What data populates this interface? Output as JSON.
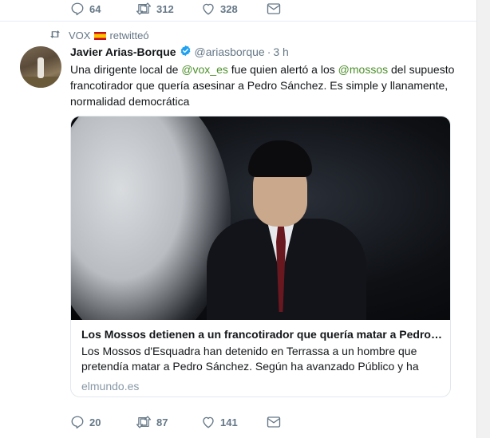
{
  "previous_tweet": {
    "reply_count": "64",
    "retweet_count": "312",
    "like_count": "328"
  },
  "retweet_context": {
    "retweeter": "VOX",
    "label": "retwitteó"
  },
  "tweet": {
    "author_name": "Javier Arias-Borque",
    "handle": "@ariasborque",
    "separator": "·",
    "time": "3 h",
    "text_parts": {
      "p1": "Una dirigente local de ",
      "m1": "@vox_es",
      "p2": " fue quien alertó a los ",
      "m2": "@mossos",
      "p3": " del supuesto francotirador que quería asesinar a Pedro Sánchez. Es simple y llanamente, normalidad democrática"
    },
    "card": {
      "title": "Los Mossos detienen a un francotirador que quería matar a Pedro Sá...",
      "description": "Los Mossos d'Esquadra han detenido en Terrassa a un hombre que pretendía matar a Pedro Sánchez. Según ha avanzado Público y ha",
      "domain": "elmundo.es"
    },
    "reply_count": "20",
    "retweet_count": "87",
    "like_count": "141"
  },
  "colors": {
    "mention": "#4c8f2a",
    "muted": "#657786",
    "verified": "#1da1f2"
  },
  "icons": [
    "reply-icon",
    "retweet-icon",
    "like-icon",
    "direct-message-icon",
    "verified-badge-icon",
    "spain-flag-icon"
  ]
}
